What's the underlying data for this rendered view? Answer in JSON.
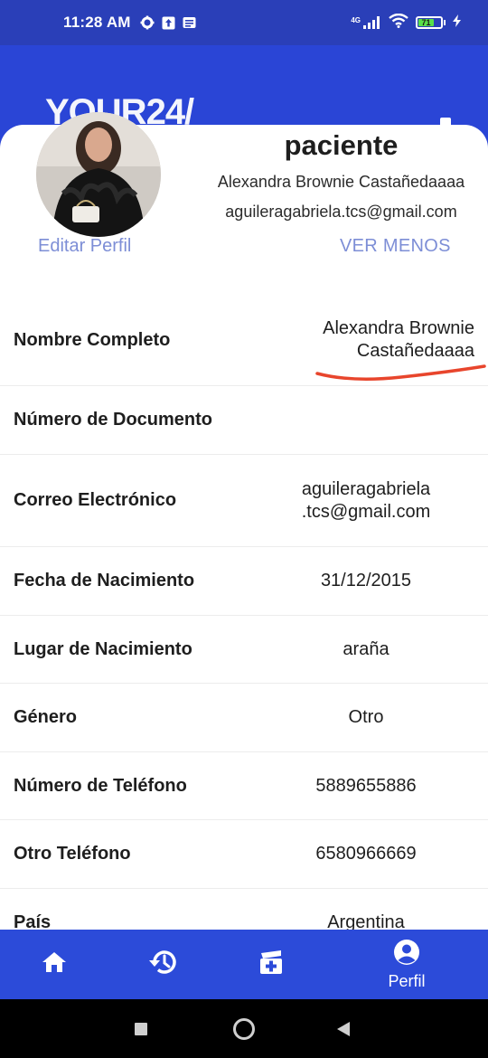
{
  "status_bar": {
    "time": "11:28 AM",
    "network": "4G",
    "battery_level": "71"
  },
  "header": {
    "brand": "YOUR24/"
  },
  "profile": {
    "role": "paciente",
    "full_name": "Alexandra Brownie Castañedaaaa",
    "email": "aguileragabriela.tcs@gmail.com",
    "edit_label": "Editar Perfil",
    "toggle_label": "VER MENOS"
  },
  "details": [
    {
      "label": "Nombre Completo",
      "value_line1": "Alexandra Brownie",
      "value_line2": "Castañedaaaa"
    },
    {
      "label": "Número de Documento",
      "value_line1": "",
      "value_line2": ""
    },
    {
      "label": "Correo Electrónico",
      "value_line1": "aguileragabriela",
      "value_line2": ".tcs@gmail.com"
    },
    {
      "label": "Fecha de Nacimiento",
      "value_line1": "31/12/2015",
      "value_line2": ""
    },
    {
      "label": "Lugar de Nacimiento",
      "value_line1": "araña",
      "value_line2": ""
    },
    {
      "label": "Género",
      "value_line1": "Otro",
      "value_line2": ""
    },
    {
      "label": "Número de Teléfono",
      "value_line1": "5889655886",
      "value_line2": ""
    },
    {
      "label": "Otro Teléfono",
      "value_line1": "6580966669",
      "value_line2": ""
    },
    {
      "label": "País",
      "value_line1": "Argentina",
      "value_line2": ""
    }
  ],
  "bottom_nav": {
    "items": [
      {
        "icon": "home-icon",
        "label": ""
      },
      {
        "icon": "history-icon",
        "label": ""
      },
      {
        "icon": "medical-add-icon",
        "label": ""
      },
      {
        "icon": "account-circle-icon",
        "label": "Perfil"
      }
    ]
  },
  "colors": {
    "primary": "#2a45d6",
    "link": "#7d8ed6",
    "annotation": "#e8452c"
  }
}
